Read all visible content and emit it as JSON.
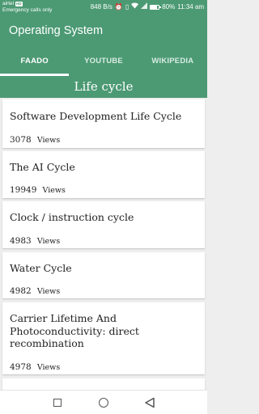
{
  "status_bar": {
    "carrier": "airtel",
    "network_badge": "HD",
    "emergency_text": "Emergency calls only",
    "speed": "848 B/s",
    "battery_percent": "80%",
    "battery_level": 0.8,
    "time": "11:34 am",
    "icons": [
      "alarm-icon",
      "vibrate-icon",
      "wifi-icon",
      "signal-icon",
      "battery-icon"
    ]
  },
  "app_bar": {
    "title": "Operating System"
  },
  "tabs": [
    {
      "label": "FAADO",
      "active": true
    },
    {
      "label": "YOUTUBE",
      "active": false
    },
    {
      "label": "WIKIPEDIA",
      "active": false
    }
  ],
  "section": {
    "title": "Life cycle"
  },
  "items": [
    {
      "title": "Software Development Life Cycle",
      "views": "3078",
      "views_label": "Views"
    },
    {
      "title": "The AI Cycle",
      "views": "19949",
      "views_label": "Views"
    },
    {
      "title": "Clock / instruction cycle",
      "views": "4983",
      "views_label": "Views"
    },
    {
      "title": "Water Cycle",
      "views": "4982",
      "views_label": "Views"
    },
    {
      "title": "Carrier Lifetime And Photoconductivity: direct recombination",
      "views": "4978",
      "views_label": "Views"
    }
  ],
  "nav_bar": {
    "buttons": [
      "recents-square-icon",
      "home-circle-icon",
      "back-triangle-icon"
    ]
  },
  "colors": {
    "primary": "#4c9a74",
    "background": "#eeeeee",
    "card": "#ffffff"
  }
}
